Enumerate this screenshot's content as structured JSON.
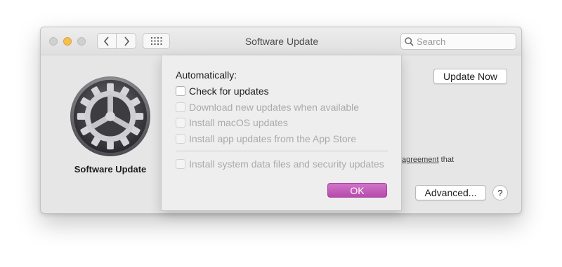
{
  "window": {
    "title": "Software Update"
  },
  "search": {
    "placeholder": "Search"
  },
  "pane": {
    "app_name": "Software Update",
    "update_now_label": "Update Now",
    "advanced_label": "Advanced...",
    "help_label": "?",
    "background_link": "agreement",
    "background_text": " that"
  },
  "sheet": {
    "heading": "Automatically:",
    "options": [
      {
        "label": "Check for updates",
        "checked": false,
        "enabled": true
      },
      {
        "label": "Download new updates when available",
        "checked": false,
        "enabled": false
      },
      {
        "label": "Install macOS updates",
        "checked": false,
        "enabled": false
      },
      {
        "label": "Install app updates from the App Store",
        "checked": false,
        "enabled": false
      },
      {
        "label": "Install system data files and security updates",
        "checked": false,
        "enabled": false
      }
    ],
    "ok_label": "OK"
  },
  "colors": {
    "accent": "#c05db8",
    "minimize": "#f6bf4f"
  },
  "icons": [
    "chevron-left-icon",
    "chevron-right-icon",
    "grid-icon",
    "search-icon",
    "gear-icon"
  ]
}
